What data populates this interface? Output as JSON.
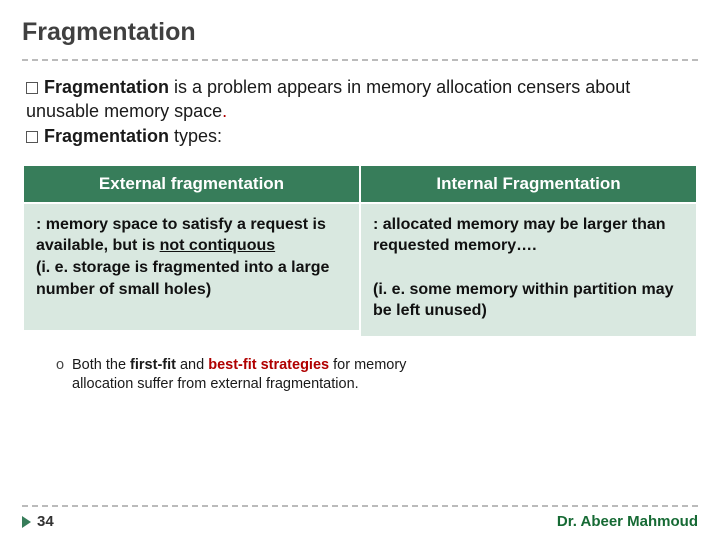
{
  "title": "Fragmentation",
  "bullets": {
    "b1_prefix": "Fragmentation",
    "b1_rest": " is a problem appears in memory allocation censers about unusable memory space",
    "b1_period": ".",
    "b2_prefix": "Fragmentation",
    "b2_rest": " types:"
  },
  "table": {
    "left_header": "External fragmentation",
    "right_header": "Internal Fragmentation",
    "left_cell_p1a": ": memory space to satisfy a request is available, but is ",
    "left_cell_p1b": "not contiquous",
    "left_cell_p2": "(i. e. storage is fragmented into a large number of small holes)",
    "right_cell_p1": ": allocated memory may be larger than requested memory…. ",
    "right_cell_p2": "(i. e. some  memory within partition may be left unused)"
  },
  "sub": {
    "marker": "o",
    "t1": "Both the ",
    "t2": "first-fit",
    "t3": " and ",
    "t4": "best-fit strategies",
    "t5": " for memory allocation suffer from external fragmentation."
  },
  "footer": {
    "page": "34",
    "author": "Dr. Abeer Mahmoud"
  }
}
